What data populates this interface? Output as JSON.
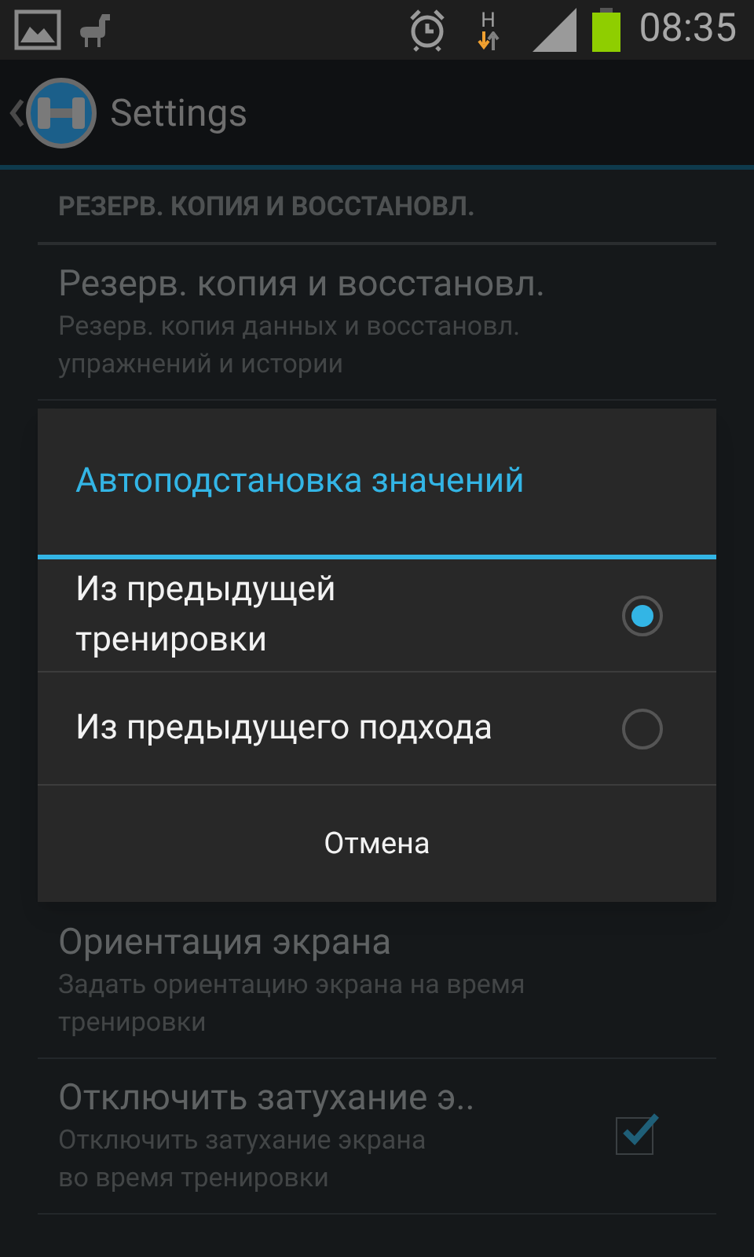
{
  "status_bar": {
    "network_type": "H",
    "time": "08:35"
  },
  "action_bar": {
    "title": "Settings"
  },
  "section": {
    "header": "РЕЗЕРВ. КОПИЯ И ВОССТАНОВЛ."
  },
  "settings": [
    {
      "kind": "plain",
      "title": "Резерв. копия и восстановл.",
      "summary": "Резерв. копия данных и восстановл.\nупражнений и истории"
    },
    {
      "kind": "plain",
      "title": "Ориентация экрана",
      "summary": "Задать ориентацию экрана на время\nтренировки"
    },
    {
      "kind": "checkbox",
      "title": "Отключить затухание э..",
      "summary": "Отключить затухание экрана\nво время тренировки",
      "checked": true
    }
  ],
  "dialog": {
    "title": "Автоподстановка значений",
    "options": [
      {
        "label": "Из предыдущей\nтренировки",
        "selected": true
      },
      {
        "label": "Из предыдущего подхода",
        "selected": false
      }
    ],
    "button": "Отмена"
  }
}
